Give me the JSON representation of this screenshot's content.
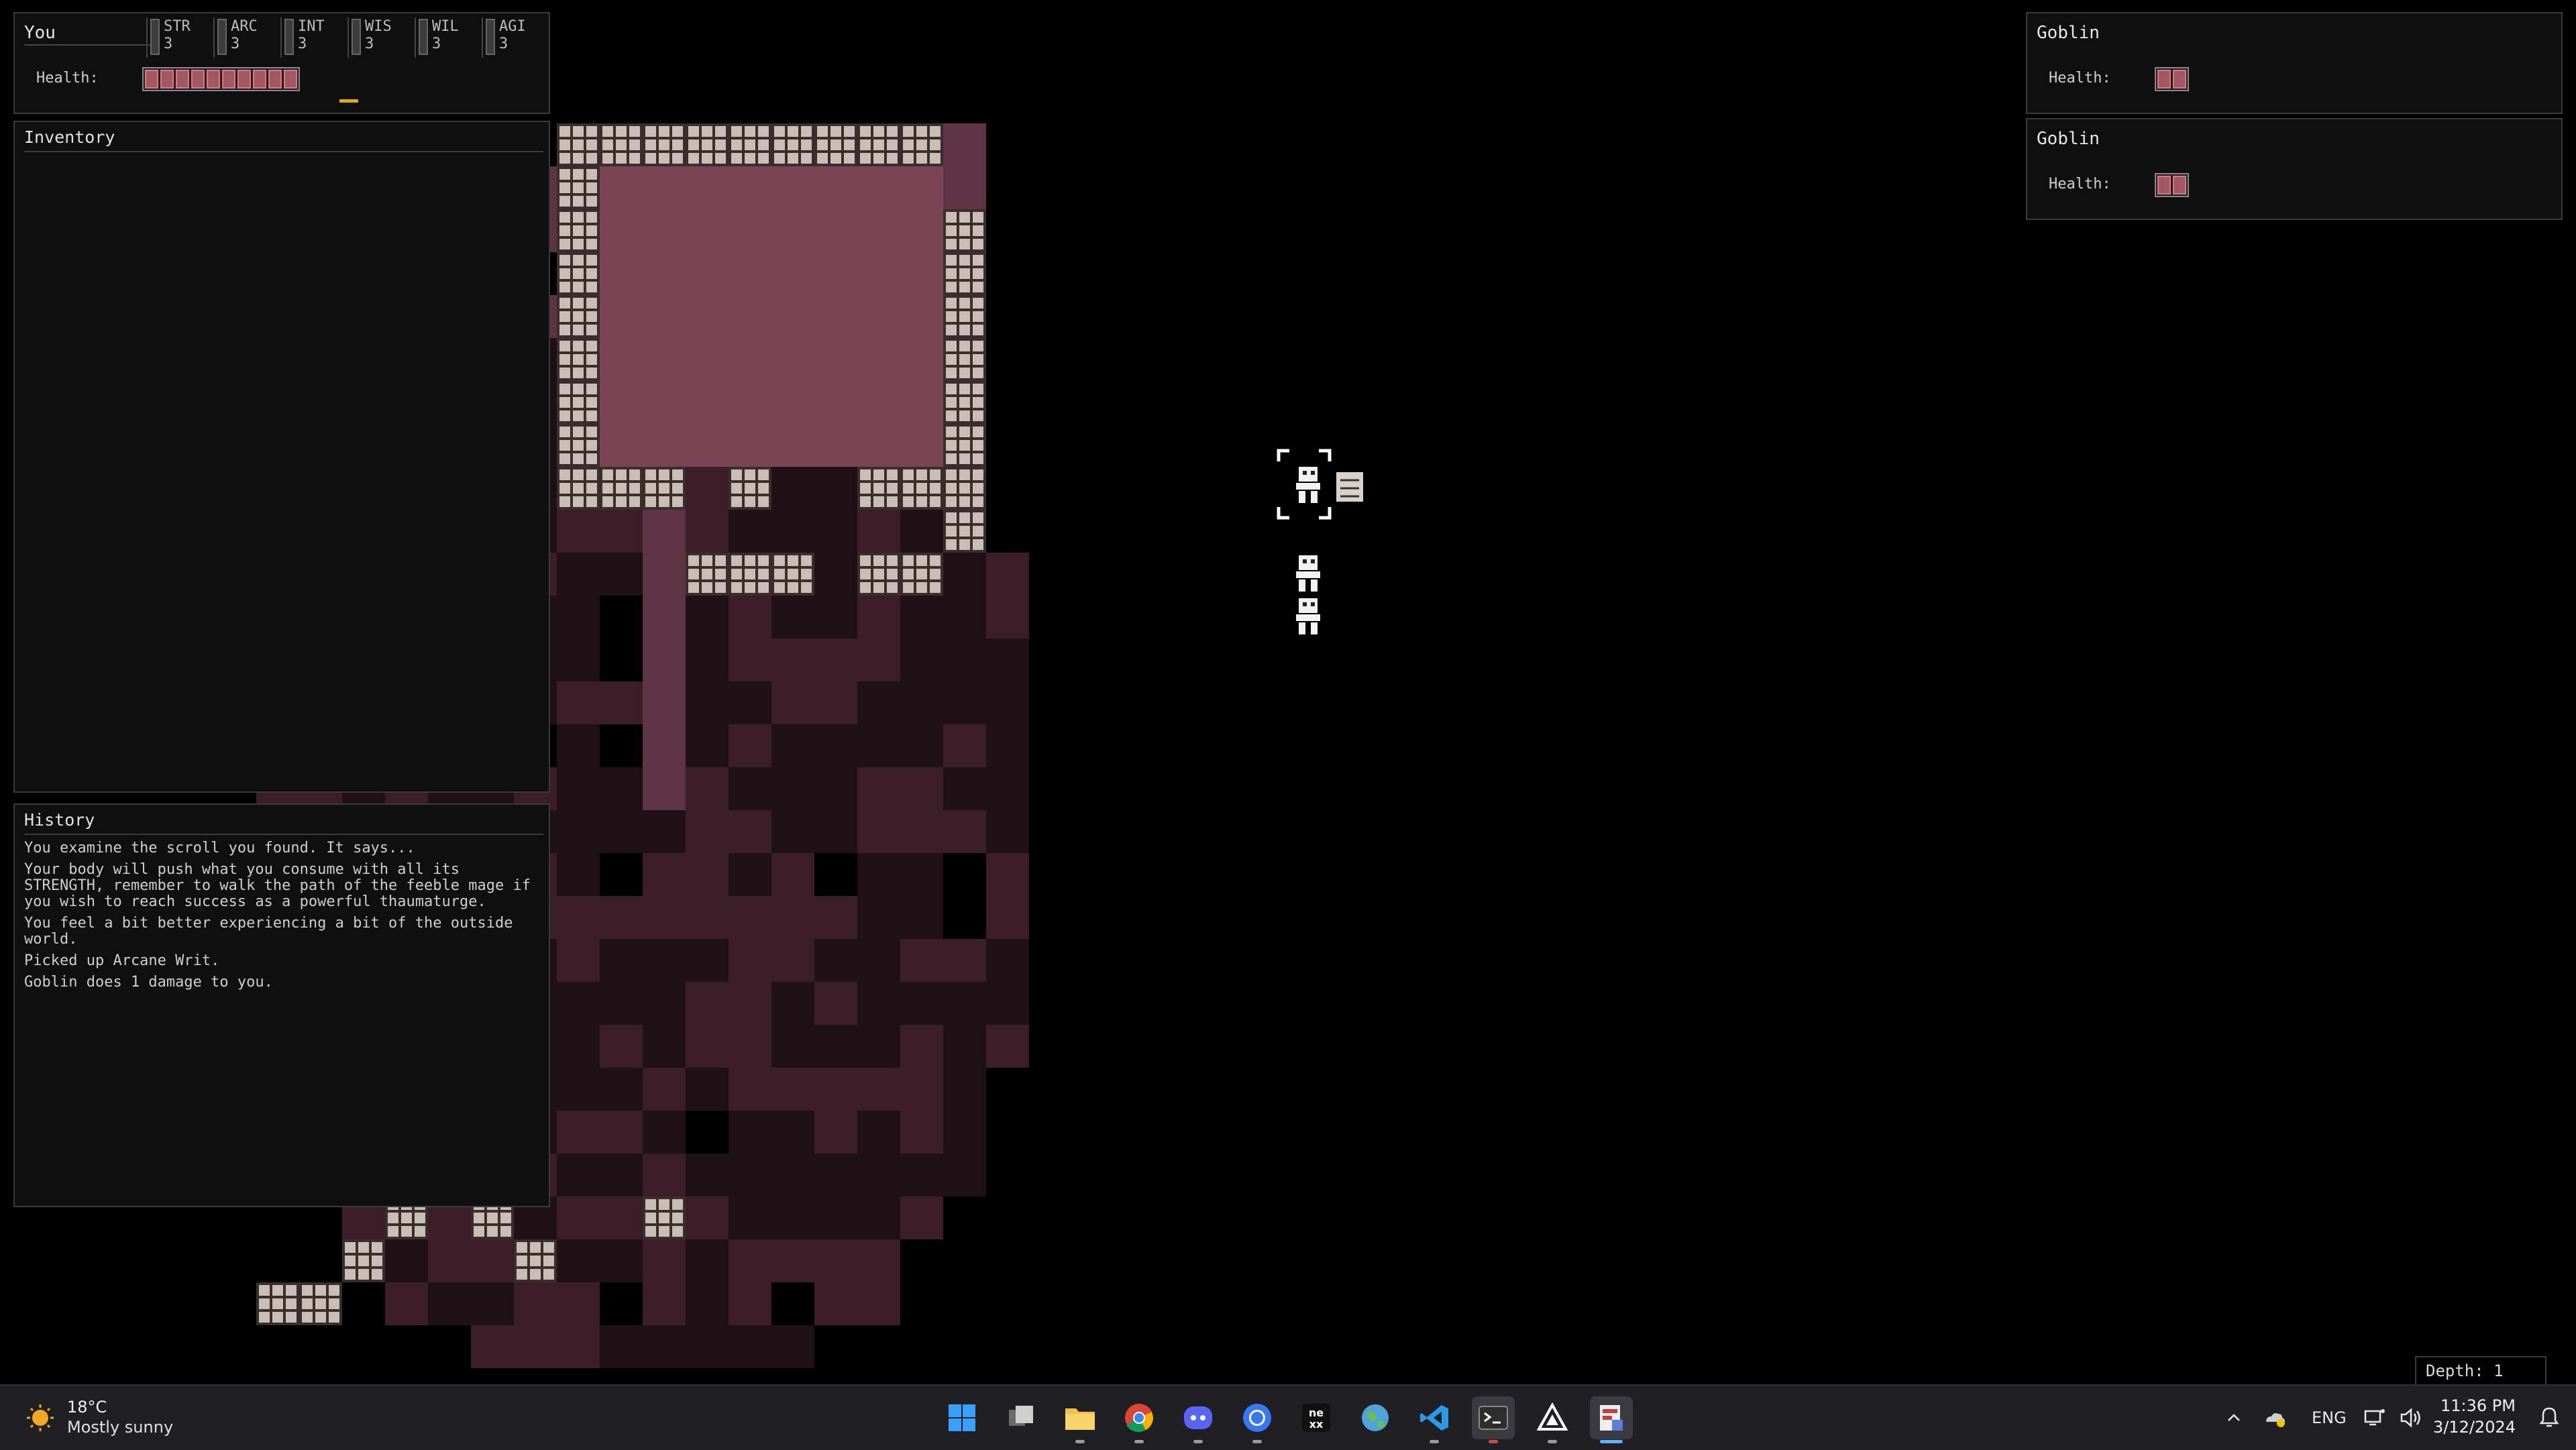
{
  "player": {
    "name": "You",
    "stats": [
      {
        "name": "STR",
        "value": "3"
      },
      {
        "name": "ARC",
        "value": "3"
      },
      {
        "name": "INT",
        "value": "3"
      },
      {
        "name": "WIS",
        "value": "3"
      },
      {
        "name": "WIL",
        "value": "3"
      },
      {
        "name": "AGI",
        "value": "3"
      }
    ],
    "health_label": "Health:",
    "health_max": 10,
    "health_current": 10
  },
  "inventory": {
    "title": "Inventory"
  },
  "history": {
    "title": "History",
    "lines": [
      "You examine the scroll you found. It says...",
      "Your body will push what you consume with all its STRENGTH, remember to walk the path of the feeble mage if you wish to reach success as a powerful thaumaturge.",
      "You feel a bit better experiencing a bit of the outside world.",
      "Picked up Arcane Writ.",
      "Goblin does 1 damage to you."
    ]
  },
  "enemies": [
    {
      "name": "Goblin",
      "health_label": "Health:",
      "health": 2
    },
    {
      "name": "Goblin",
      "health_label": "Health:",
      "health": 2
    }
  ],
  "depth": "Depth: 1",
  "colors": {
    "floor_lit": "#7a4455",
    "floor_dim": "#3a1d26",
    "floor_dark": "#1f1016",
    "wall": "#c9bdb8",
    "health_pip": "#a35762",
    "accent": "#e0b000"
  },
  "taskbar": {
    "weather_temp": "18°C",
    "weather_desc": "Mostly sunny",
    "apps": [
      "windows-start",
      "task-view",
      "file-explorer",
      "chrome",
      "discord",
      "signal",
      "nexus-mods",
      "earth-app",
      "vscode",
      "terminal",
      "affinity-app",
      "game-app"
    ],
    "lang": "ENG",
    "time": "11:36 PM",
    "date": "3/12/2024"
  }
}
